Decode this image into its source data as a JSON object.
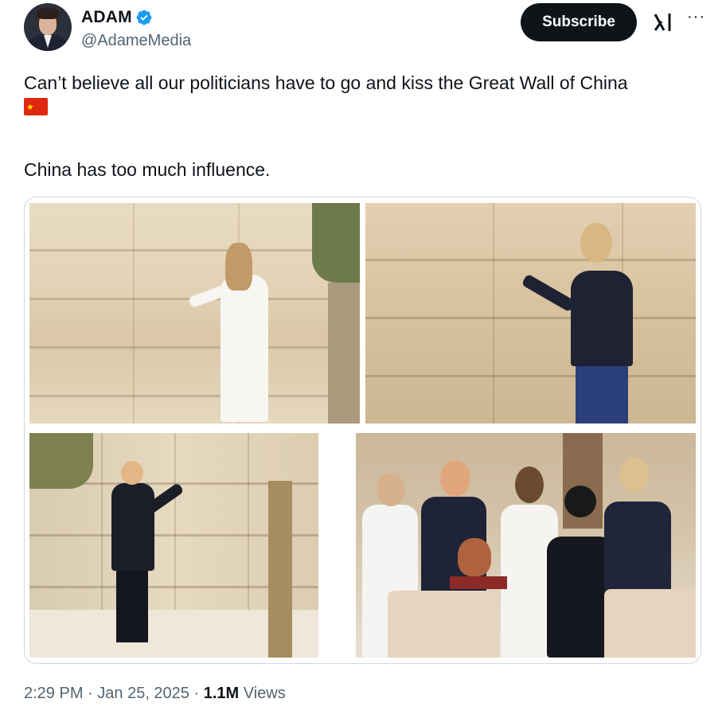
{
  "author": {
    "name": "ADAM",
    "handle": "@AdameMedia",
    "verified": true,
    "verified_color": "#1d9bf0"
  },
  "actions": {
    "subscribe_label": "Subscribe",
    "grok_icon": "grok-icon",
    "more_label": "···"
  },
  "tweet": {
    "text_line1": "Can’t believe all our politicians have to go and kiss the Great Wall of China",
    "flag_emoji": "china-flag",
    "text_line2": "China has too much influence."
  },
  "media": {
    "photo_count": 4
  },
  "footer": {
    "time": "2:29 PM",
    "separator": " · ",
    "date": "Jan 25, 2025",
    "views_count": "1.1M",
    "views_label": "Views"
  },
  "colors": {
    "text": "#0f1419",
    "secondary": "#536471",
    "subscribe_bg": "#0f1419",
    "border": "#cfd9de"
  }
}
